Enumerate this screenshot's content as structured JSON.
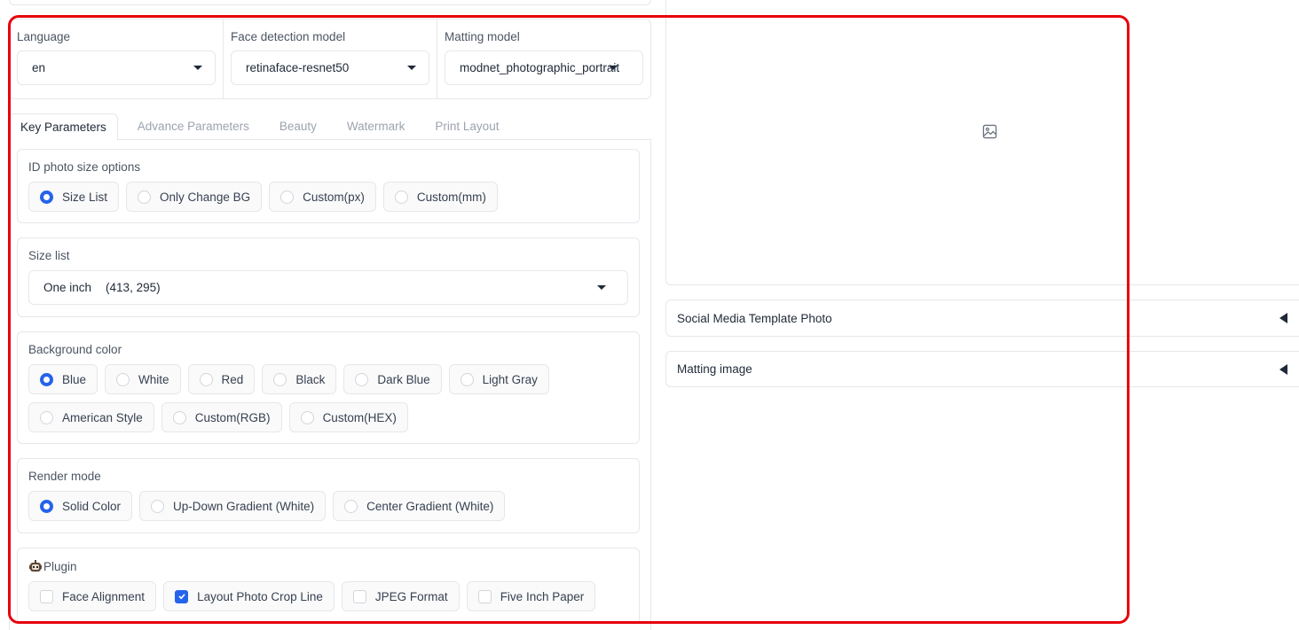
{
  "settings": {
    "language": {
      "label": "Language",
      "value": "en"
    },
    "face_model": {
      "label": "Face detection model",
      "value": "retinaface-resnet50"
    },
    "matting_model": {
      "label": "Matting model",
      "value": "modnet_photographic_portrait"
    }
  },
  "tabs": [
    {
      "label": "Key Parameters",
      "active": true
    },
    {
      "label": "Advance Parameters",
      "active": false
    },
    {
      "label": "Beauty",
      "active": false
    },
    {
      "label": "Watermark",
      "active": false
    },
    {
      "label": "Print Layout",
      "active": false
    }
  ],
  "size_options": {
    "label": "ID photo size options",
    "options": [
      "Size List",
      "Only Change BG",
      "Custom(px)",
      "Custom(mm)"
    ],
    "selected": "Size List"
  },
  "size_list": {
    "label": "Size list",
    "value": "One inch\t\t(413, 295)",
    "value_name": "One inch",
    "value_dims": "(413, 295)"
  },
  "background_color": {
    "label": "Background color",
    "options": [
      "Blue",
      "White",
      "Red",
      "Black",
      "Dark Blue",
      "Light Gray",
      "American Style",
      "Custom(RGB)",
      "Custom(HEX)"
    ],
    "selected": "Blue"
  },
  "render_mode": {
    "label": "Render mode",
    "options": [
      "Solid Color",
      "Up-Down Gradient (White)",
      "Center Gradient (White)"
    ],
    "selected": "Solid Color"
  },
  "plugin": {
    "label": "Plugin",
    "icon": "robot-emoji",
    "options": [
      {
        "label": "Face Alignment",
        "checked": false
      },
      {
        "label": "Layout Photo Crop Line",
        "checked": true
      },
      {
        "label": "JPEG Format",
        "checked": false
      },
      {
        "label": "Five Inch Paper",
        "checked": false
      }
    ]
  },
  "output": {
    "image_placeholder_icon": "image-icon",
    "accordions": [
      "Social Media Template Photo",
      "Matting image"
    ]
  },
  "colors": {
    "accent": "#2563eb",
    "highlight": "#e8000b",
    "border": "#e5e7eb"
  }
}
